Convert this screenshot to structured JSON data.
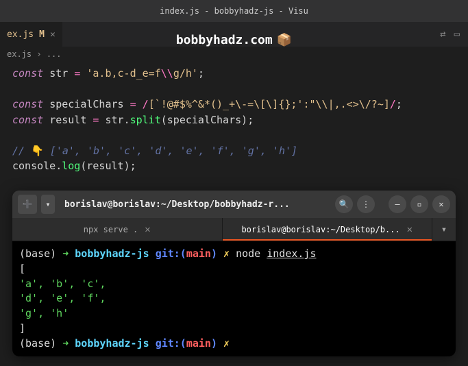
{
  "window": {
    "title": "index.js - bobbyhadz-js - Visu"
  },
  "watermark": {
    "text": "bobbyhadz.com",
    "icon": "📦"
  },
  "tab": {
    "name": "ex.js",
    "modified_indicator": "M",
    "close": "✕"
  },
  "breadcrumb": {
    "path": "ex.js",
    "sep": "›",
    "dots": "..."
  },
  "code": {
    "l1": {
      "kw": "const",
      "var": "str",
      "op": "=",
      "s1": "'a.b,c-d_e=f",
      "esc": "\\\\",
      "s2": "g/h'",
      "semi": ";"
    },
    "l3": {
      "kw": "const",
      "var": "specialChars",
      "op": "=",
      "r_open": "/",
      "r_body": "[`!@#$%^&*()_+\\-=\\[\\]{};':\"\\\\|,.<>\\/?~]",
      "r_close": "/",
      "semi": ";"
    },
    "l4": {
      "kw": "const",
      "var": "result",
      "op": "=",
      "obj": "str",
      "dot": ".",
      "fn": "split",
      "po": "(",
      "arg": "specialChars",
      "pc": ")",
      "semi": ";"
    },
    "l6": {
      "c1": "// ",
      "emoji": "👇",
      "c2": " ['a', 'b', 'c', 'd', 'e', 'f', 'g', 'h']"
    },
    "l7": {
      "obj": "console",
      "dot": ".",
      "fn": "log",
      "po": "(",
      "arg": "result",
      "pc": ")",
      "semi": ";"
    }
  },
  "terminal": {
    "titlebar": {
      "new_tab_icon": "➕",
      "dropdown_icon": "▾",
      "title": "borislav@borislav:~/Desktop/bobbyhadz-r...",
      "search_icon": "🔍",
      "menu_icon": "⋮",
      "min_icon": "–",
      "max_icon": "▫",
      "close_icon": "✕"
    },
    "tabs": {
      "t1": {
        "label": "npx serve .",
        "close": "✕"
      },
      "t2": {
        "label": "borislav@borislav:~/Desktop/b...",
        "close": "✕"
      },
      "menu": "▾"
    },
    "output": {
      "p1": {
        "base": "(base)",
        "arrow": "➜",
        "dir": "bobbyhadz-js",
        "git": "git:(",
        "branch": "main",
        "gitc": ")",
        "dirty": "✗",
        "cmd1": "node",
        "cmd2": "index.js"
      },
      "arr_open": "[",
      "row1": "  'a', 'b', 'c',",
      "row2": "  'd', 'e', 'f',",
      "row3": "  'g', 'h'",
      "arr_close": "]",
      "p2": {
        "base": "(base)",
        "arrow": "➜",
        "dir": "bobbyhadz-js",
        "git": "git:(",
        "branch": "main",
        "gitc": ")",
        "dirty": "✗"
      }
    }
  }
}
